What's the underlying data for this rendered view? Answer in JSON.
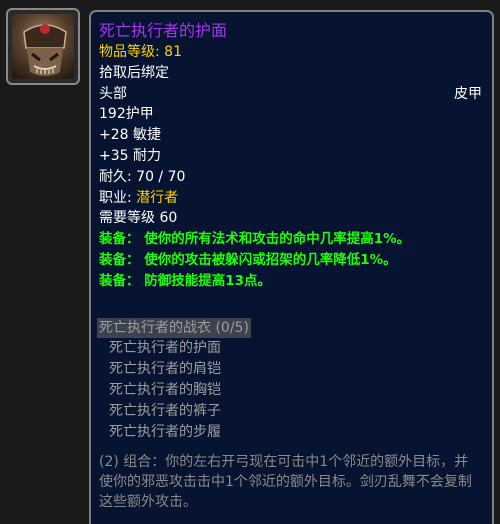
{
  "item": {
    "name": "死亡执行者的护面",
    "item_level_label": "物品等级",
    "item_level": "81",
    "binding": "拾取后绑定",
    "slot": "头部",
    "armor_type": "皮甲",
    "armor": "192护甲",
    "stats": [
      "+28 敏捷",
      "+35 耐力"
    ],
    "durability_label": "耐久",
    "durability": "70 / 70",
    "class_label": "职业",
    "class": "潜行者",
    "level_requirement": "需要等级 60",
    "equip_effects": [
      {
        "label": "装备：",
        "text": "使你的所有法术和攻击的命中几率提高1%。"
      },
      {
        "label": "装备：",
        "text": "使你的攻击被躲闪或招架的几率降低1%。"
      },
      {
        "label": "装备：",
        "text": "防御技能提高13点。"
      }
    ]
  },
  "set": {
    "name": "死亡执行者的战衣 (0/5)",
    "pieces": [
      "死亡执行者的护面",
      "死亡执行者的肩铠",
      "死亡执行者的胸铠",
      "死亡执行者的裤子",
      "死亡执行者的步履"
    ],
    "bonus": "(2) 组合：你的左右开弓现在可击中1个邻近的额外目标，并使你的邪恶攻击击中1个邻近的额外目标。剑刃乱舞不会复制这些额外攻击。"
  },
  "colors": {
    "epic": "#a335ee",
    "gold": "#ffd100",
    "green": "#1eff00",
    "gray": "#9d9d9d",
    "tooltip_bg": "#061431"
  },
  "icon": "rogue-helmet-icon"
}
